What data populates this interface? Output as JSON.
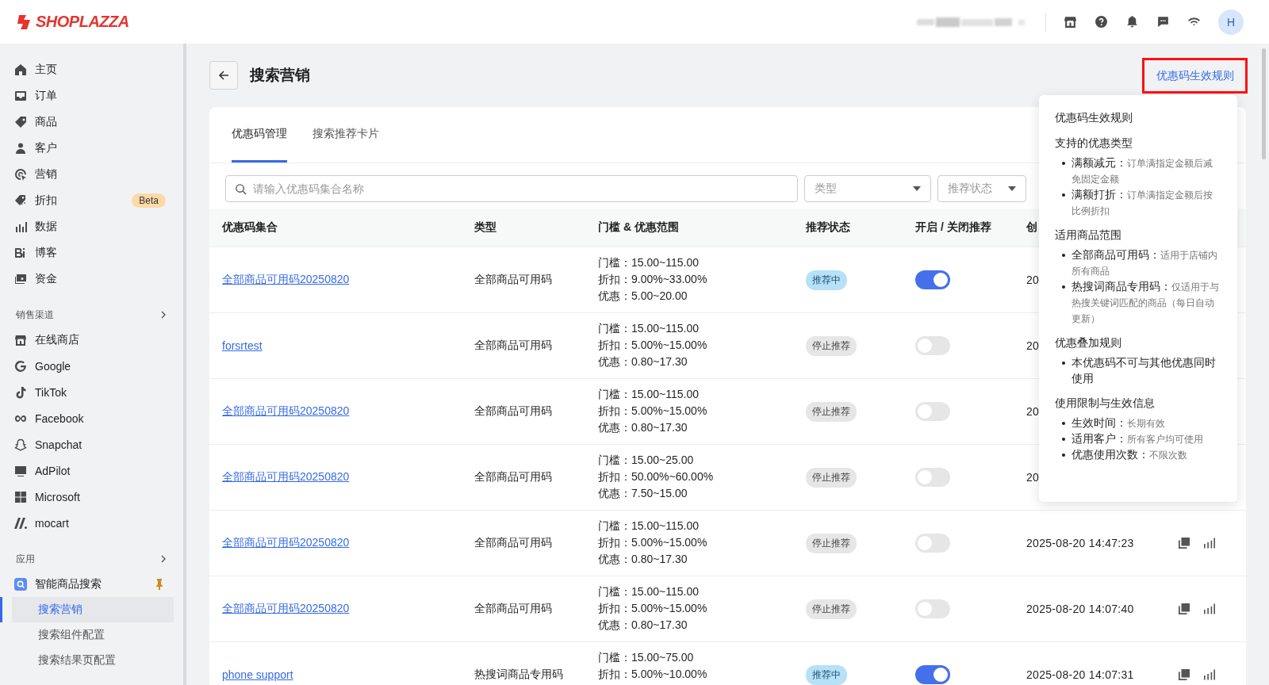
{
  "topbar": {
    "logo": "SHOPLAZZA",
    "avatar": "H"
  },
  "sidebar": {
    "main": [
      {
        "label": "主页"
      },
      {
        "label": "订单"
      },
      {
        "label": "商品"
      },
      {
        "label": "客户"
      },
      {
        "label": "营销"
      },
      {
        "label": "折扣",
        "badge": "Beta"
      },
      {
        "label": "数据"
      },
      {
        "label": "博客"
      },
      {
        "label": "资金"
      }
    ],
    "channels_heading": "销售渠道",
    "channels": [
      {
        "label": "在线商店"
      },
      {
        "label": "Google"
      },
      {
        "label": "TikTok"
      },
      {
        "label": "Facebook"
      },
      {
        "label": "Snapchat"
      },
      {
        "label": "AdPilot"
      },
      {
        "label": "Microsoft"
      },
      {
        "label": "mocart"
      }
    ],
    "apps_heading": "应用",
    "app": {
      "label": "智能商品搜索",
      "children": [
        {
          "label": "搜索营销",
          "selected": true
        },
        {
          "label": "搜索组件配置",
          "selected": false
        },
        {
          "label": "搜索结果页配置",
          "selected": false
        }
      ]
    }
  },
  "page": {
    "title": "搜索营销",
    "rules_link": "优惠码生效规则"
  },
  "tabs": [
    {
      "label": "优惠码管理",
      "selected": true
    },
    {
      "label": "搜索推荐卡片",
      "selected": false
    }
  ],
  "filters": {
    "search_placeholder": "请输入优惠码集合名称",
    "selects": [
      "类型",
      "推荐状态"
    ]
  },
  "table": {
    "columns": [
      "优惠码集合",
      "类型",
      "门槛 & 优惠范围",
      "推荐状态",
      "开启 / 关闭推荐",
      "创"
    ],
    "rows": [
      {
        "name": "全部商品可用码20250820",
        "type": "全部商品可用码",
        "range": [
          "门槛：15.00~115.00",
          "折扣：9.00%~33.00%",
          "优惠：5.00~20.00"
        ],
        "status": {
          "label": "推荐中",
          "active": true
        },
        "enabled": true,
        "created": "20"
      },
      {
        "name": "forsrtest",
        "type": "全部商品可用码",
        "range": [
          "门槛：15.00~115.00",
          "折扣：5.00%~15.00%",
          "优惠：0.80~17.30"
        ],
        "status": {
          "label": "停止推荐",
          "active": false
        },
        "enabled": false,
        "created": "20"
      },
      {
        "name": "全部商品可用码20250820",
        "type": "全部商品可用码",
        "range": [
          "门槛：15.00~115.00",
          "折扣：5.00%~15.00%",
          "优惠：0.80~17.30"
        ],
        "status": {
          "label": "停止推荐",
          "active": false
        },
        "enabled": false,
        "created": "20"
      },
      {
        "name": "全部商品可用码20250820",
        "type": "全部商品可用码",
        "range": [
          "门槛：15.00~25.00",
          "折扣：50.00%~60.00%",
          "优惠：7.50~15.00"
        ],
        "status": {
          "label": "停止推荐",
          "active": false
        },
        "enabled": false,
        "created": "20"
      },
      {
        "name": "全部商品可用码20250820",
        "type": "全部商品可用码",
        "range": [
          "门槛：15.00~115.00",
          "折扣：5.00%~15.00%",
          "优惠：0.80~17.30"
        ],
        "status": {
          "label": "停止推荐",
          "active": false
        },
        "enabled": false,
        "created": "2025-08-20 14:47:23"
      },
      {
        "name": "全部商品可用码20250820",
        "type": "全部商品可用码",
        "range": [
          "门槛：15.00~115.00",
          "折扣：5.00%~15.00%",
          "优惠：0.80~17.30"
        ],
        "status": {
          "label": "停止推荐",
          "active": false
        },
        "enabled": false,
        "created": "2025-08-20 14:07:40"
      },
      {
        "name": "phone support",
        "type": "热搜词商品专用码",
        "range": [
          "门槛：15.00~75.00",
          "折扣：5.00%~10.00%"
        ],
        "status": {
          "label": "推荐中",
          "active": true
        },
        "enabled": true,
        "created": "2025-08-20 14:07:31"
      }
    ]
  },
  "popover": {
    "title": "优惠码生效规则",
    "sections": [
      {
        "heading": "支持的优惠类型",
        "items": [
          {
            "term": "满额减元：",
            "desc": "订单满指定金额后减免固定金额"
          },
          {
            "term": "满额打折：",
            "desc": "订单满指定金额后按比例折扣"
          }
        ]
      },
      {
        "heading": "适用商品范围",
        "items": [
          {
            "term": "全部商品可用码：",
            "desc": "适用于店铺内所有商品"
          },
          {
            "term": "热搜词商品专用码：",
            "desc": "仅适用于与热搜关键词匹配的商品（每日自动更新）"
          }
        ]
      },
      {
        "heading": "优惠叠加规则",
        "items": [
          {
            "term": "本优惠码不可与其他优惠同时使用"
          }
        ]
      },
      {
        "heading": "使用限制与生效信息",
        "items": [
          {
            "term": "生效时间：",
            "desc": "长期有效"
          },
          {
            "term": "适用客户：",
            "desc": "所有客户均可使用"
          },
          {
            "term": "优惠使用次数：",
            "desc": "不限次数"
          }
        ]
      }
    ]
  }
}
